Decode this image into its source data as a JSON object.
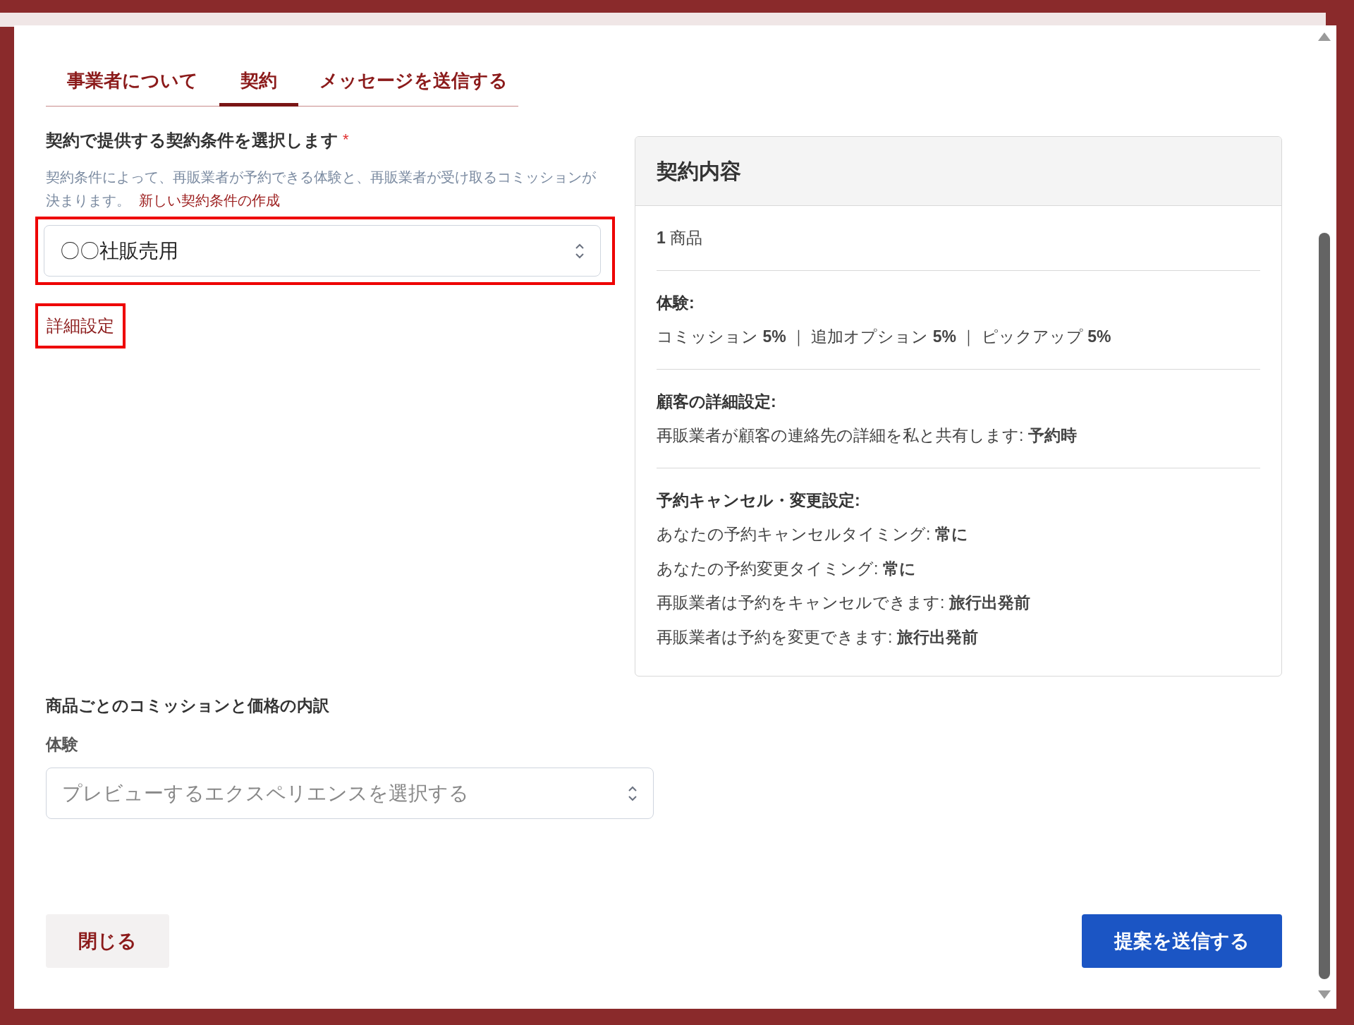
{
  "tabs": [
    {
      "label": "事業者について",
      "selected": false
    },
    {
      "label": "契約",
      "selected": true
    },
    {
      "label": "メッセージを送信する",
      "selected": false
    }
  ],
  "terms_field": {
    "label": "契約で提供する契約条件を選択します",
    "required_mark": "*",
    "help": "契約条件によって、再販業者が予約できる体験と、再販業者が受け取るコミッションが決まります。",
    "link": "新しい契約条件の作成",
    "value": "〇〇社販売用",
    "highlighted": true
  },
  "advanced_link": {
    "label": "詳細設定",
    "highlighted": true
  },
  "summary": {
    "title": "契約内容",
    "sections": [
      {
        "lines": [
          "**1** 商品"
        ]
      },
      {
        "heading": "体験:",
        "lines": [
          "コミッション **5%** ｜ 追加オプション **5%** ｜ ピックアップ **5%**"
        ]
      },
      {
        "heading": "顧客の詳細設定:",
        "lines": [
          "再販業者が顧客の連絡先の詳細を私と共有します: **予約時**"
        ]
      },
      {
        "heading": "予約キャンセル・変更設定:",
        "lines": [
          "あなたの予約キャンセルタイミング: **常に**",
          "あなたの予約変更タイミング: **常に**",
          "再販業者は予約をキャンセルできます: **旅行出発前**",
          "再販業者は予約を変更できます: **旅行出発前**"
        ]
      }
    ]
  },
  "breakdown": {
    "title": "商品ごとのコミッションと価格の内訳",
    "label": "体験",
    "placeholder": "プレビューするエクスペリエンスを選択する"
  },
  "buttons": [
    {
      "label": "閉じる",
      "kind": "secondary"
    },
    {
      "label": "提案を送信する",
      "kind": "primary"
    }
  ]
}
